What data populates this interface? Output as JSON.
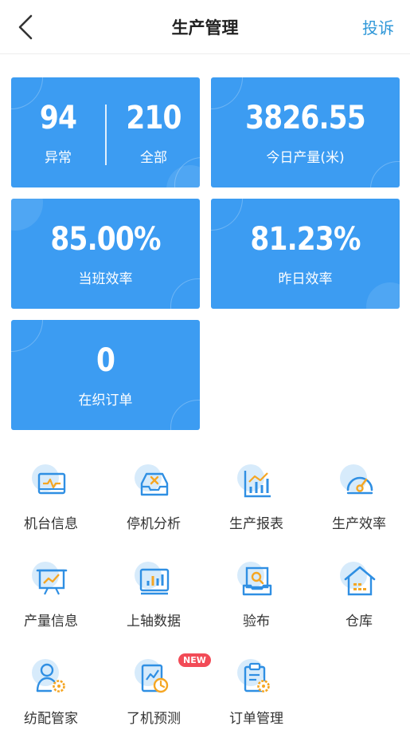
{
  "header": {
    "title": "生产管理",
    "complaint_label": "投诉"
  },
  "stats": {
    "abnormal": {
      "value": "94",
      "label": "异常"
    },
    "all": {
      "value": "210",
      "label": "全部"
    },
    "today_output": {
      "value": "3826.55",
      "label": "今日产量(米)"
    },
    "shift_efficiency": {
      "value": "85.00%",
      "label": "当班效率"
    },
    "yesterday_efficiency": {
      "value": "81.23%",
      "label": "昨日效率"
    },
    "orders_in_weaving": {
      "value": "0",
      "label": "在织订单"
    }
  },
  "menu": [
    {
      "label": "机台信息",
      "icon": "monitor-icon"
    },
    {
      "label": "停机分析",
      "icon": "tray-x-icon"
    },
    {
      "label": "生产报表",
      "icon": "bar-chart-icon"
    },
    {
      "label": "生产效率",
      "icon": "gauge-icon"
    },
    {
      "label": "产量信息",
      "icon": "presentation-icon"
    },
    {
      "label": "上轴数据",
      "icon": "screen-bars-icon"
    },
    {
      "label": "验布",
      "icon": "inspect-icon"
    },
    {
      "label": "仓库",
      "icon": "warehouse-icon"
    },
    {
      "label": "纺配管家",
      "icon": "user-gear-icon"
    },
    {
      "label": "了机预测",
      "icon": "clock-chart-icon"
    },
    {
      "label": "订单管理",
      "icon": "clipboard-gear-icon"
    }
  ],
  "badges": {
    "new": "NEW"
  },
  "colors": {
    "card": "#3c9cf2",
    "accent": "#2e97d8",
    "icon_orange": "#f5a623",
    "badge": "#f24b57"
  }
}
